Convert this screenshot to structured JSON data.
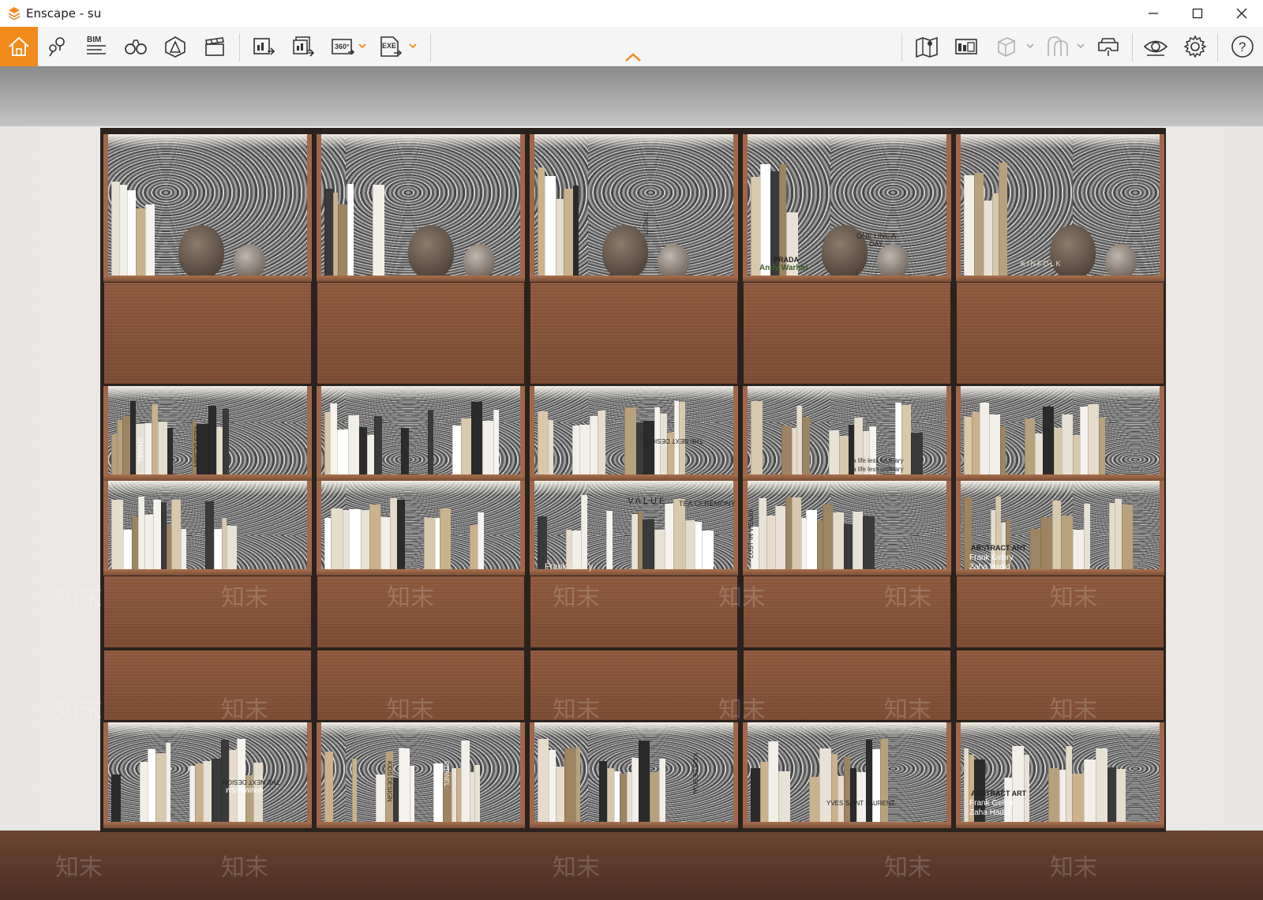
{
  "window": {
    "title": "Enscape - su",
    "app_icon": "enscape-logo-icon",
    "brand_color": "#f28a1c"
  },
  "toolbar": {
    "left_tools": [
      {
        "id": "home",
        "icon": "home-icon"
      },
      {
        "id": "views",
        "icon": "location-pins-icon"
      },
      {
        "id": "bim",
        "icon": "bim-icon",
        "label": "BIM"
      },
      {
        "id": "binoculars",
        "icon": "binoculars-icon"
      },
      {
        "id": "assets",
        "icon": "asset-library-icon"
      },
      {
        "id": "video",
        "icon": "clapperboard-icon"
      },
      {
        "id": "screenshot",
        "icon": "screenshot-export-icon"
      },
      {
        "id": "batch",
        "icon": "batch-render-icon"
      },
      {
        "id": "pano",
        "icon": "panorama-360-icon",
        "label": "360°"
      },
      {
        "id": "exe",
        "icon": "exe-export-icon",
        "label": "EXE"
      }
    ],
    "right_tools": [
      {
        "id": "map",
        "icon": "map-icon"
      },
      {
        "id": "info",
        "icon": "info-panel-icon"
      },
      {
        "id": "cube",
        "icon": "cube-icon"
      },
      {
        "id": "tunnel",
        "icon": "arch-tunnel-icon"
      },
      {
        "id": "vr",
        "icon": "vr-headset-icon"
      },
      {
        "id": "visibility",
        "icon": "eye-icon"
      },
      {
        "id": "settings",
        "icon": "gear-icon"
      },
      {
        "id": "help",
        "icon": "help-icon",
        "label": "?"
      }
    ]
  },
  "viewport": {
    "book_labels": {
      "kinfolk": "KINFOLK",
      "one_line_a_day": "ONE LINE A DAY",
      "prada": "PRADA",
      "andy_warhol": "Andy Warhol",
      "rivers": "RIVERS",
      "value": "VALUE",
      "tea_ceremony": "TEA CEREMONY",
      "frank_gehry": "Frank Gehry",
      "abstract_art": "ABSTRACT ART",
      "zaha_hadid": "Zaha Hadid",
      "kids_design": "KIDS DESIGN",
      "chanel": "CHANEL",
      "life_less_ordinary": "a life less ordinary",
      "lost_in_vienna": "LOST IN VIENNA",
      "yves": "YVES SAINT LAURENT",
      "the_next_design": "THE NEXT DESIGN",
      "minimalism": "MINIMALISM"
    },
    "watermark_text": "知末"
  }
}
